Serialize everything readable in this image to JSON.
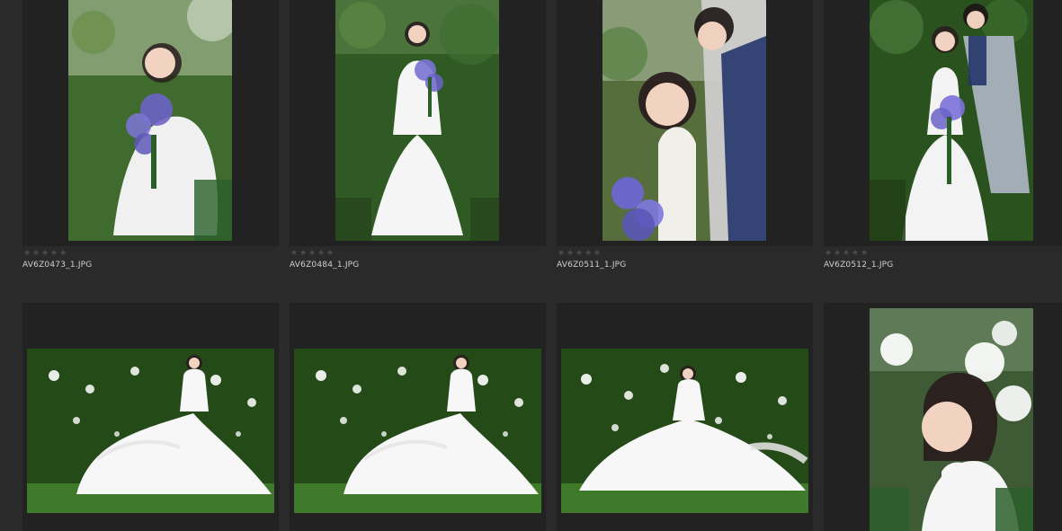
{
  "grid": {
    "rows": [
      [
        {
          "filename": "AV6Z0473_1.JPG",
          "rating": 0,
          "max_rating": 5,
          "orientation": "portrait",
          "subject": "bride-with-flowers",
          "palette": {
            "bg": "#3f6b2f",
            "accent": "#f0f0f0",
            "flower": "#6b63c7"
          }
        },
        {
          "filename": "AV6Z0484_1.JPG",
          "rating": 0,
          "max_rating": 5,
          "orientation": "portrait",
          "subject": "bride-full-length",
          "palette": {
            "bg": "#2f5a24",
            "accent": "#f5f5f5",
            "flower": "#7b73d4"
          }
        },
        {
          "filename": "AV6Z0511_1.JPG",
          "rating": 0,
          "max_rating": 5,
          "orientation": "portrait",
          "subject": "couple-closeup",
          "palette": {
            "bg": "#566d3c",
            "accent": "#f1efe9",
            "flower": "#6c67d0"
          }
        },
        {
          "filename": "AV6Z0512_1.JPG",
          "rating": 0,
          "max_rating": 5,
          "orientation": "portrait",
          "subject": "couple-seated",
          "palette": {
            "bg": "#29521f",
            "accent": "#f3f3f3",
            "flower": "#7b72d8"
          }
        }
      ],
      [
        {
          "filename": "",
          "rating": 0,
          "max_rating": 5,
          "orientation": "landscape",
          "subject": "bride-gown-spread",
          "palette": {
            "bg": "#244a18",
            "accent": "#f7f7f7",
            "flower": "#ffffff"
          }
        },
        {
          "filename": "",
          "rating": 0,
          "max_rating": 5,
          "orientation": "landscape",
          "subject": "bride-gown-spread",
          "palette": {
            "bg": "#244a18",
            "accent": "#f7f7f7",
            "flower": "#ffffff"
          }
        },
        {
          "filename": "",
          "rating": 0,
          "max_rating": 5,
          "orientation": "landscape",
          "subject": "bride-gown-motion",
          "palette": {
            "bg": "#244a18",
            "accent": "#f7f7f7",
            "flower": "#ffffff"
          }
        },
        {
          "filename": "",
          "rating": 0,
          "max_rating": 5,
          "orientation": "portrait",
          "subject": "bride-portrait-blossoms",
          "palette": {
            "bg": "#3f5b35",
            "accent": "#f5f5f5",
            "flower": "#ffffff"
          }
        }
      ]
    ]
  }
}
